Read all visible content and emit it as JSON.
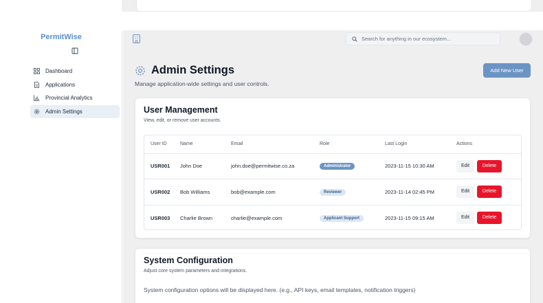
{
  "brand": {
    "name": "PermitWise"
  },
  "sidebar": {
    "items": [
      {
        "label": "Dashboard",
        "icon": "grid-icon",
        "active": false
      },
      {
        "label": "Applications",
        "icon": "document-icon",
        "active": false
      },
      {
        "label": "Provincial Analytics",
        "icon": "bar-chart-icon",
        "active": false
      },
      {
        "label": "Admin Settings",
        "icon": "gear-icon",
        "active": true
      }
    ]
  },
  "topbar": {
    "search_placeholder": "Search for anything in our ecosystem..."
  },
  "page": {
    "title": "Admin Settings",
    "subtitle": "Manage application-wide settings and user controls.",
    "add_button": "Add New User"
  },
  "user_management": {
    "title": "User Management",
    "description": "View, edit, or remove user accounts.",
    "columns": [
      "User ID",
      "Name",
      "Email",
      "Role",
      "Last Login",
      "Actions"
    ],
    "rows": [
      {
        "id": "USR001",
        "name": "John Doe",
        "email": "john.doe@permitwise.co.za",
        "role": "Administrator",
        "last_login": "2023-11-15 10:30 AM",
        "edit": "Edit",
        "delete": "Delete"
      },
      {
        "id": "USR002",
        "name": "Bob Williams",
        "email": "bob@example.com",
        "role": "Reviewer",
        "last_login": "2023-11-14 02:45 PM",
        "edit": "Edit",
        "delete": "Delete"
      },
      {
        "id": "USR003",
        "name": "Charlie Brown",
        "email": "charlie@example.com",
        "role": "Applicant Support",
        "last_login": "2023-11-15 09:15 AM",
        "edit": "Edit",
        "delete": "Delete"
      }
    ]
  },
  "system_config": {
    "title": "System Configuration",
    "description": "Adjust core system parameters and integrations.",
    "body": "System configuration options will be displayed here. (e.g., API keys, email templates, notification triggers)"
  },
  "colors": {
    "accent": "#6b94c4",
    "brand": "#5a8fcf",
    "danger": "#e8152a"
  }
}
